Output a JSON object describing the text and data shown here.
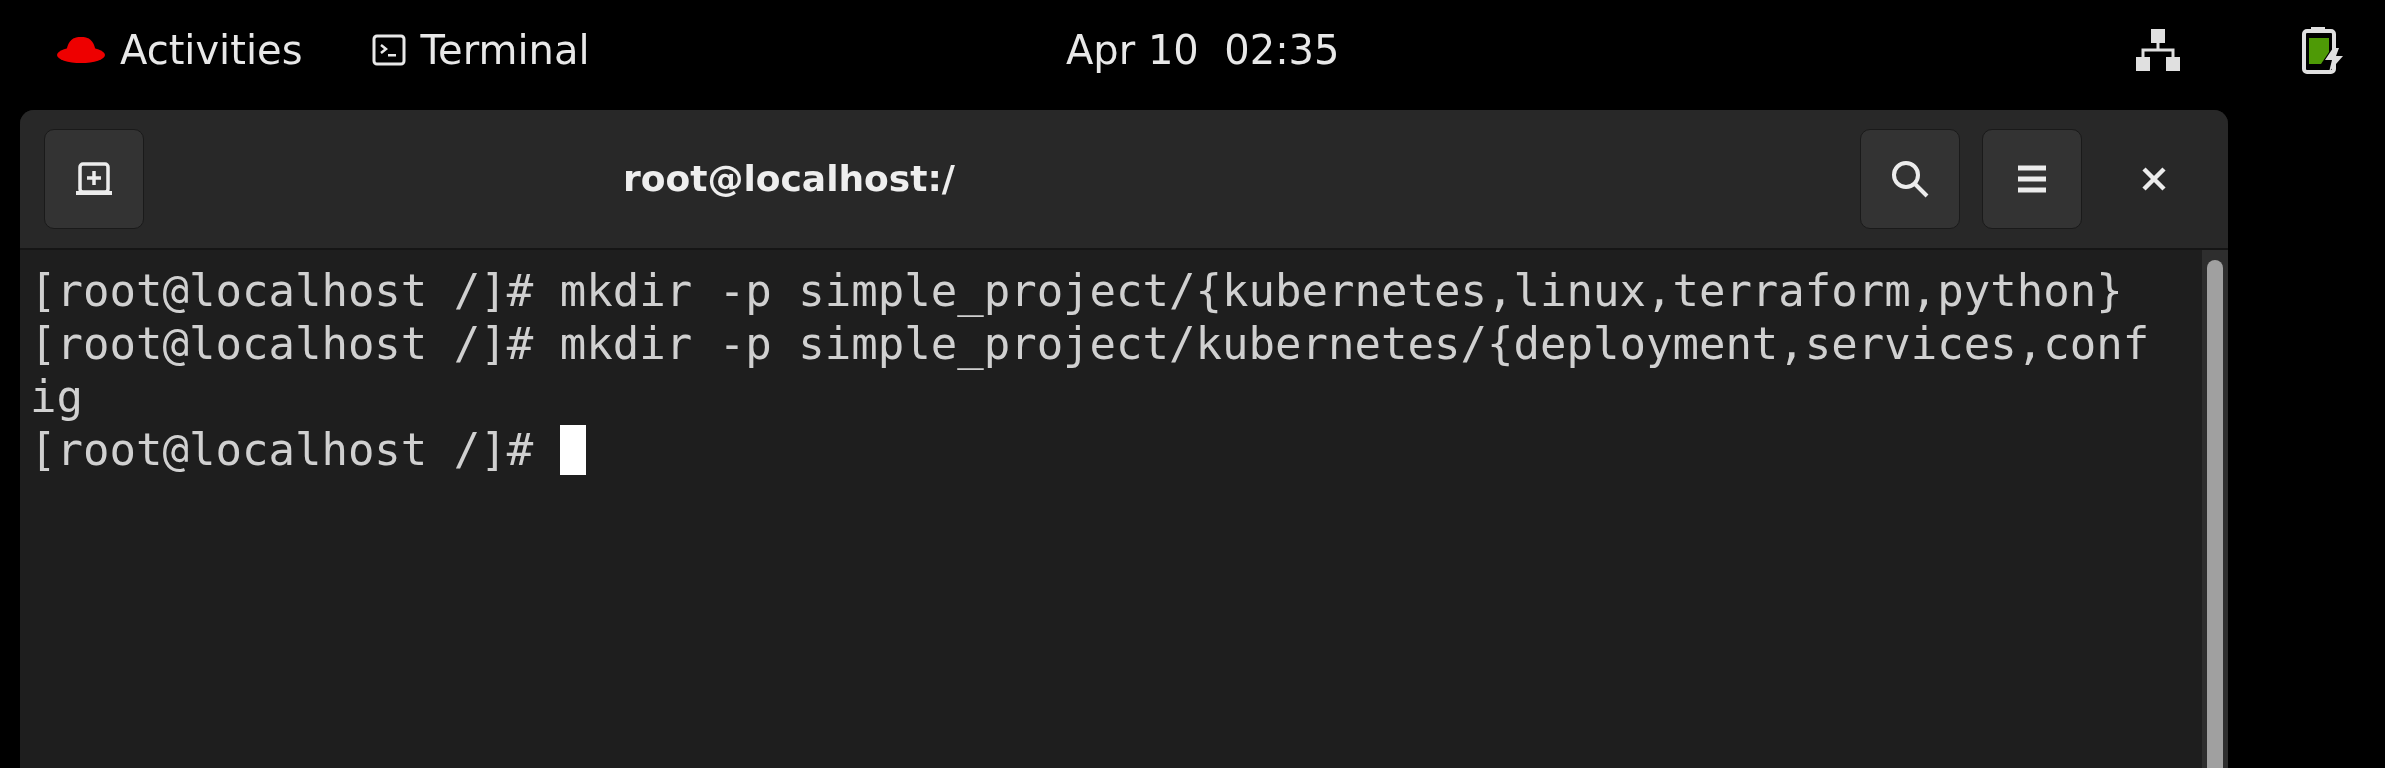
{
  "top_bar": {
    "activities": "Activities",
    "app_name": "Terminal",
    "clock": "Apr 10  02:35"
  },
  "window": {
    "title": "root@localhost:/"
  },
  "terminal": {
    "lines": [
      {
        "text": "[root@localhost /]# mkdir -p simple_project/{kubernetes,linux,terraform,python}"
      },
      {
        "text": "[root@localhost /]# mkdir -p simple_project/kubernetes/{deployment,services,conf"
      },
      {
        "text": "ig"
      },
      {
        "text": "[root@localhost /]# "
      }
    ]
  }
}
